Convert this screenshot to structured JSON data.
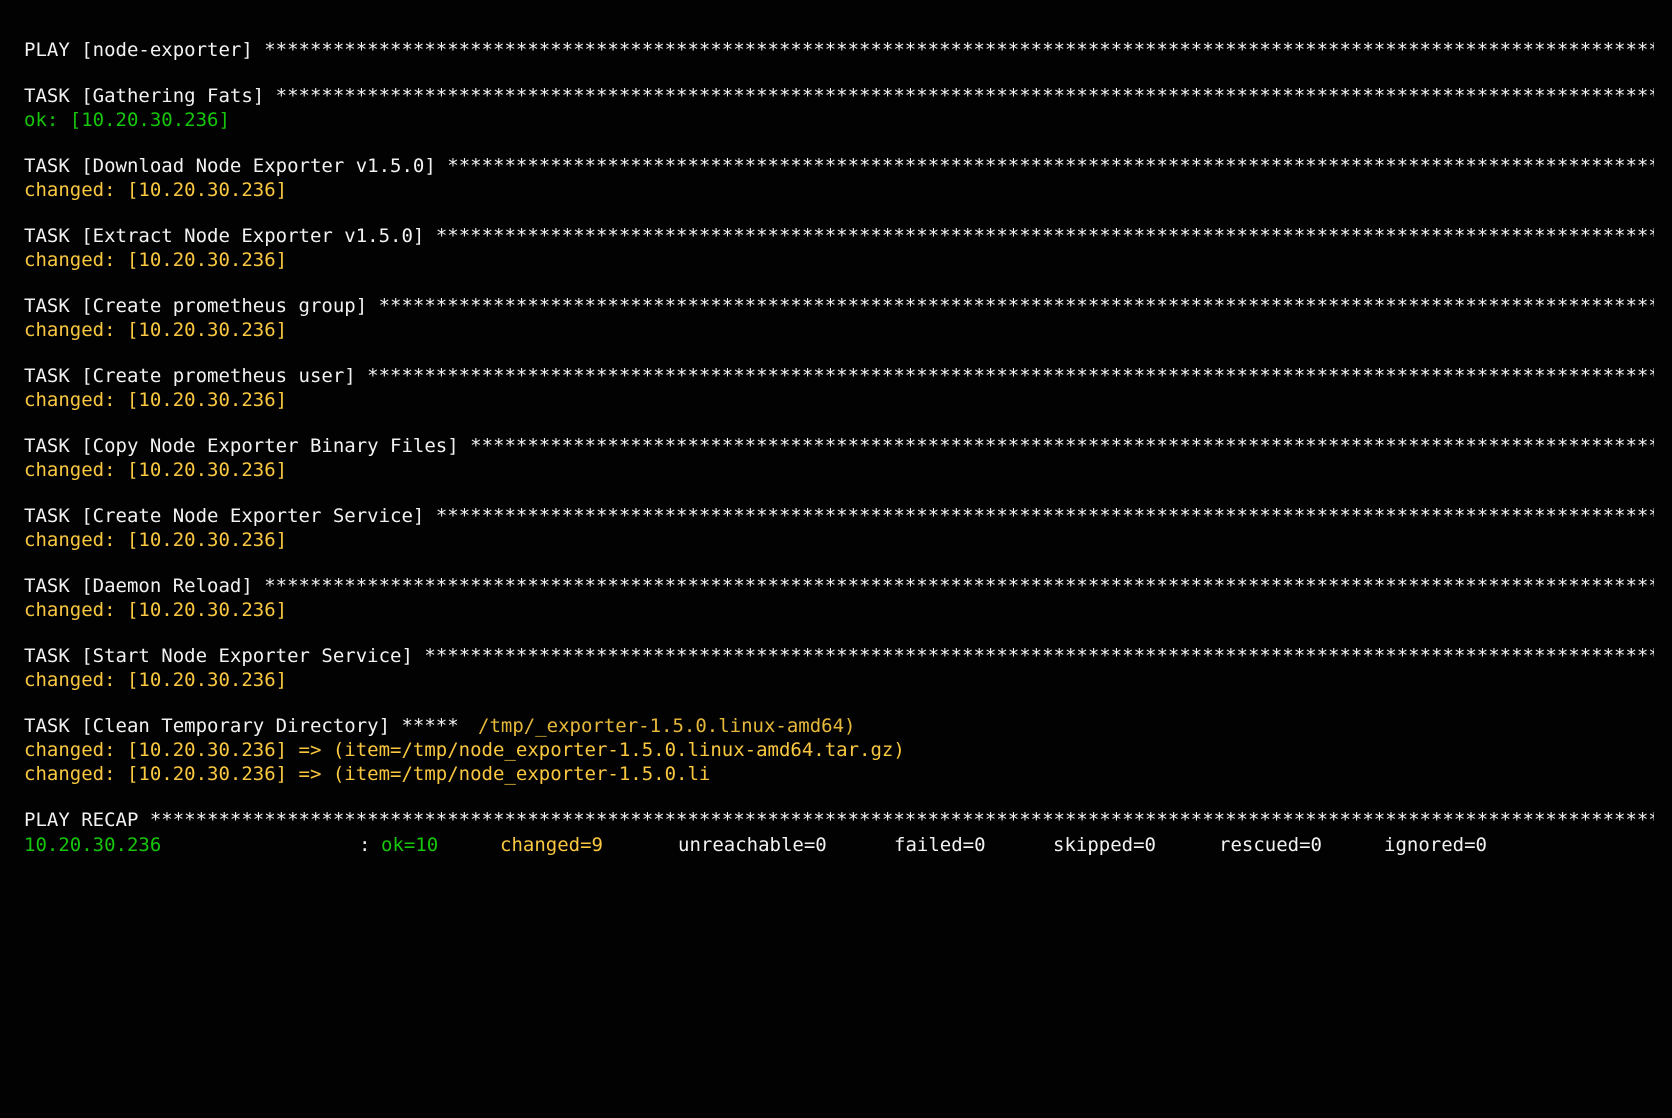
{
  "play": {
    "header": "PLAY [node-exporter]"
  },
  "tasks": [
    {
      "title": "TASK [Gathering Fats]",
      "result": "ok: [10.20.30.236]",
      "status": "ok"
    },
    {
      "title": "TASK [Download Node Exporter v1.5.0]",
      "result": "changed: [10.20.30.236]",
      "status": "changed"
    },
    {
      "title": "TASK [Extract Node Exporter v1.5.0]",
      "result": "changed: [10.20.30.236]",
      "status": "changed"
    },
    {
      "title": "TASK [Create prometheus group]",
      "result": "changed: [10.20.30.236]",
      "status": "changed"
    },
    {
      "title": "TASK [Create prometheus user]",
      "result": "changed: [10.20.30.236]",
      "status": "changed"
    },
    {
      "title": "TASK [Copy Node Exporter Binary Files]",
      "result": "changed: [10.20.30.236]",
      "status": "changed"
    },
    {
      "title": "TASK [Create Node Exporter Service]",
      "result": "changed: [10.20.30.236]",
      "status": "changed"
    },
    {
      "title": "TASK [Daemon Reload]",
      "result": "changed: [10.20.30.236]",
      "status": "changed"
    },
    {
      "title": "TASK [Start Node Exporter Service]",
      "result": "changed: [10.20.30.236]",
      "status": "changed"
    }
  ],
  "clean_task": {
    "title": "TASK [Clean Temporary Directory]",
    "stars": "*****",
    "overlap": "/tmp/_exporter-1.5.0.linux-amd64)",
    "result_1": "changed: [10.20.30.236] => (item=/tmp/node_exporter-1.5.0.linux-amd64.tar.gz)",
    "result_2": "changed: [10.20.30.236] => (item=/tmp/node_exporter-1.5.0.li"
  },
  "recap": {
    "header": "PLAY RECAP",
    "host": "10.20.30.236",
    "colon": ":",
    "ok": "ok=10",
    "changed": "changed=9",
    "unreachable": "unreachable=0",
    "failed": "failed=0",
    "skipped": "skipped=0",
    "rescued": "rescued=0",
    "ignored": "ignored=0"
  },
  "colors": {
    "background": "#020202",
    "text": "#f2f2f2",
    "ok": "#16c60c",
    "changed": "#f9c840"
  }
}
